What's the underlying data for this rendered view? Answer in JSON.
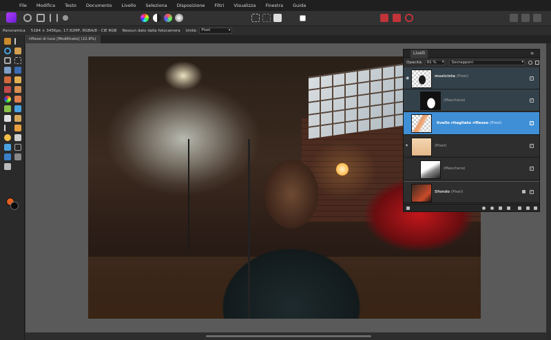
{
  "menu": [
    "File",
    "Modifica",
    "Testo",
    "Documento",
    "Livello",
    "Seleziona",
    "Disposizione",
    "Filtri",
    "Visualizza",
    "Finestra",
    "Guida"
  ],
  "context_bar": {
    "tool_name": "Panoramica",
    "image_info": "5184 × 3456px, 17.92MP, RGBA/8 - CIE RGB",
    "camera_info": "Nessun dato dalla fotocamera",
    "units_label": "Unità:",
    "units_value": "Pixel"
  },
  "document_tab": {
    "title": "riflessi di luce [Modificato] (22.8%)"
  },
  "swatches": {
    "foreground": "#e25f22",
    "background": "#0a0a0a"
  },
  "layers_panel": {
    "tab_label": "Livelli",
    "opacity_label": "Opacità:",
    "opacity_value": "91 %",
    "blend_mode": "Sovrapponi",
    "layers": [
      {
        "name": "musicista",
        "type": "(Pixel)",
        "visible": true,
        "selected": false,
        "indent": 0
      },
      {
        "name": "",
        "type": "(Maschera)",
        "visible": true,
        "selected": false,
        "indent": 1
      },
      {
        "name": "livello ritagliato riflesso",
        "type": "(Pixel)",
        "visible": true,
        "selected": true,
        "indent": 0
      },
      {
        "name": "",
        "type": "(Pixel)",
        "visible": true,
        "selected": false,
        "indent": 0
      },
      {
        "name": "",
        "type": "(Maschera)",
        "visible": true,
        "selected": false,
        "indent": 1
      },
      {
        "name": "Sfondo",
        "type": "(Pixel)",
        "visible": true,
        "selected": false,
        "indent": 0
      }
    ]
  },
  "colors": {
    "selection": "#3f8fd6",
    "accent": "#9b34ef"
  }
}
